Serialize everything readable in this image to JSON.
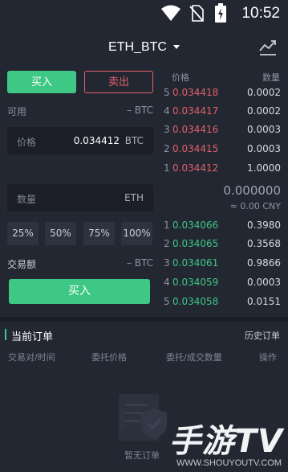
{
  "status_bar": {
    "time": "10:52"
  },
  "header": {
    "pair": "ETH_BTC"
  },
  "trade_tabs": {
    "buy": "买入",
    "sell": "卖出"
  },
  "available": {
    "label": "可用",
    "value": "– BTC"
  },
  "price_field": {
    "placeholder": "价格",
    "value": "0.034412",
    "unit": "BTC"
  },
  "amount_field": {
    "placeholder": "数量",
    "unit": "ETH"
  },
  "percent_buttons": [
    "25%",
    "50%",
    "75%",
    "100%"
  ],
  "turnover": {
    "label": "交易额",
    "value": "– BTC"
  },
  "buy_button": "买入",
  "orderbook": {
    "price_header": "价格",
    "qty_header": "数量",
    "asks": [
      {
        "idx": "5",
        "price": "0.034418",
        "qty": "0.0002"
      },
      {
        "idx": "4",
        "price": "0.034417",
        "qty": "0.0002"
      },
      {
        "idx": "3",
        "price": "0.034416",
        "qty": "0.0003"
      },
      {
        "idx": "2",
        "price": "0.034415",
        "qty": "0.0003"
      },
      {
        "idx": "1",
        "price": "0.034412",
        "qty": "1.0000"
      }
    ],
    "last_price": "0.000000",
    "last_cny": "≈ 0.00 CNY",
    "bids": [
      {
        "idx": "1",
        "price": "0.034066",
        "qty": "0.3980"
      },
      {
        "idx": "2",
        "price": "0.034065",
        "qty": "0.3568"
      },
      {
        "idx": "3",
        "price": "0.034061",
        "qty": "0.9866"
      },
      {
        "idx": "4",
        "price": "0.034059",
        "qty": "0.0003"
      },
      {
        "idx": "5",
        "price": "0.034058",
        "qty": "0.0151"
      }
    ]
  },
  "orders": {
    "title": "当前订单",
    "history": "历史订单",
    "columns": [
      "交易对/时间",
      "委托价格",
      "委托/成交数量",
      "操作"
    ],
    "empty": "暂无订单"
  },
  "watermark": {
    "text": "手游TV",
    "url": "WWW.SHOUYOUTV.COM"
  },
  "colors": {
    "buy": "#3ec785",
    "sell": "#e0606a",
    "background": "#232732"
  }
}
